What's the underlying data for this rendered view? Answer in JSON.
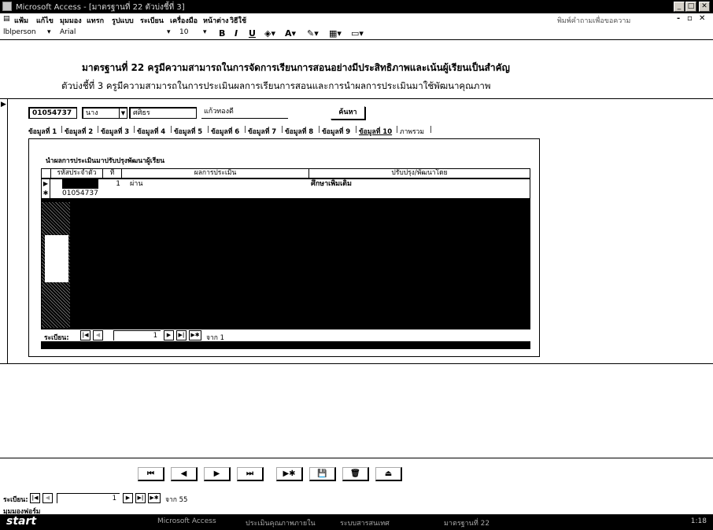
{
  "window": {
    "title": "Microsoft Access - [มาตรฐานที่ 22 ตัวบ่งชี้ที่ 3]"
  },
  "menu": {
    "items": [
      "แฟ้ม",
      "แก้ไข",
      "มุมมอง",
      "แทรก",
      "รูปแบบ",
      "ระเบียน",
      "เครื่องมือ",
      "หน้าต่าง",
      "วิธีใช้"
    ],
    "help_placeholder": "พิมพ์คำถามเพื่อขอความ"
  },
  "format_toolbar": {
    "object": "lblperson",
    "font": "Arial",
    "size": "10",
    "bold": "B",
    "italic": "I",
    "underline": "U"
  },
  "header": {
    "standard": "มาตรฐานที่ 22 ครูมีความสามารถในการจัดการเรียนการสอนอย่างมีประสิทธิภาพและเน้นผู้เรียนเป็นสำคัญ",
    "indicator": "ตัวบ่งชี้ที่ 3 ครูมีความสามารถในการประเมินผลการเรียนการสอนและการนำผลการประเมินมาใช้พัฒนาคุณภาพ"
  },
  "person": {
    "id": "01054737",
    "title": "นาง",
    "first_name": "ศศิธร",
    "last_name": "แก้วทองดี",
    "search_label": "ค้นหา"
  },
  "tabs": [
    "ข้อมูลที่ 1",
    "ข้อมูลที่ 2",
    "ข้อมูลที่ 3",
    "ข้อมูลที่ 4",
    "ข้อมูลที่ 5",
    "ข้อมูลที่ 6",
    "ข้อมูลที่ 7",
    "ข้อมูลที่ 8",
    "ข้อมูลที่ 9",
    "ข้อมูลที่ 10",
    "ภาพรวม"
  ],
  "active_tab": 9,
  "subform": {
    "caption": "นำผลการประเมินมาปรับปรุงพัฒนาผู้เรียน",
    "columns": [
      "รหัสประจำตัว",
      "ที่",
      "ผลการประเมิน",
      "ปรับปรุง/พัฒนาโดย"
    ],
    "rows": [
      {
        "selector": "▶",
        "id": "",
        "no": "1",
        "result": "ผ่าน",
        "improve": "ศึกษาเพิ่มเติม"
      },
      {
        "selector": "✱",
        "id": "01054737",
        "no": "",
        "result": "",
        "improve": ""
      }
    ],
    "nav": {
      "label": "ระเบียน:",
      "current": "1",
      "of": "จาก 1"
    }
  },
  "footer_buttons": [
    "⏮",
    "◀",
    "▶",
    "⏭",
    "▶✱",
    "💾",
    "🗑",
    "⏏"
  ],
  "main_nav": {
    "label": "ระเบียน:",
    "current": "1",
    "of": "จาก 55"
  },
  "status_text": "มุมมองฟอร์ม",
  "taskbar": {
    "start": "start",
    "tasks": [
      "Microsoft Access",
      "ประเมินคุณภาพภายใน",
      "ระบบสารสนเทศ",
      "มาตรฐานที่ 22"
    ],
    "clock": "1:18"
  }
}
